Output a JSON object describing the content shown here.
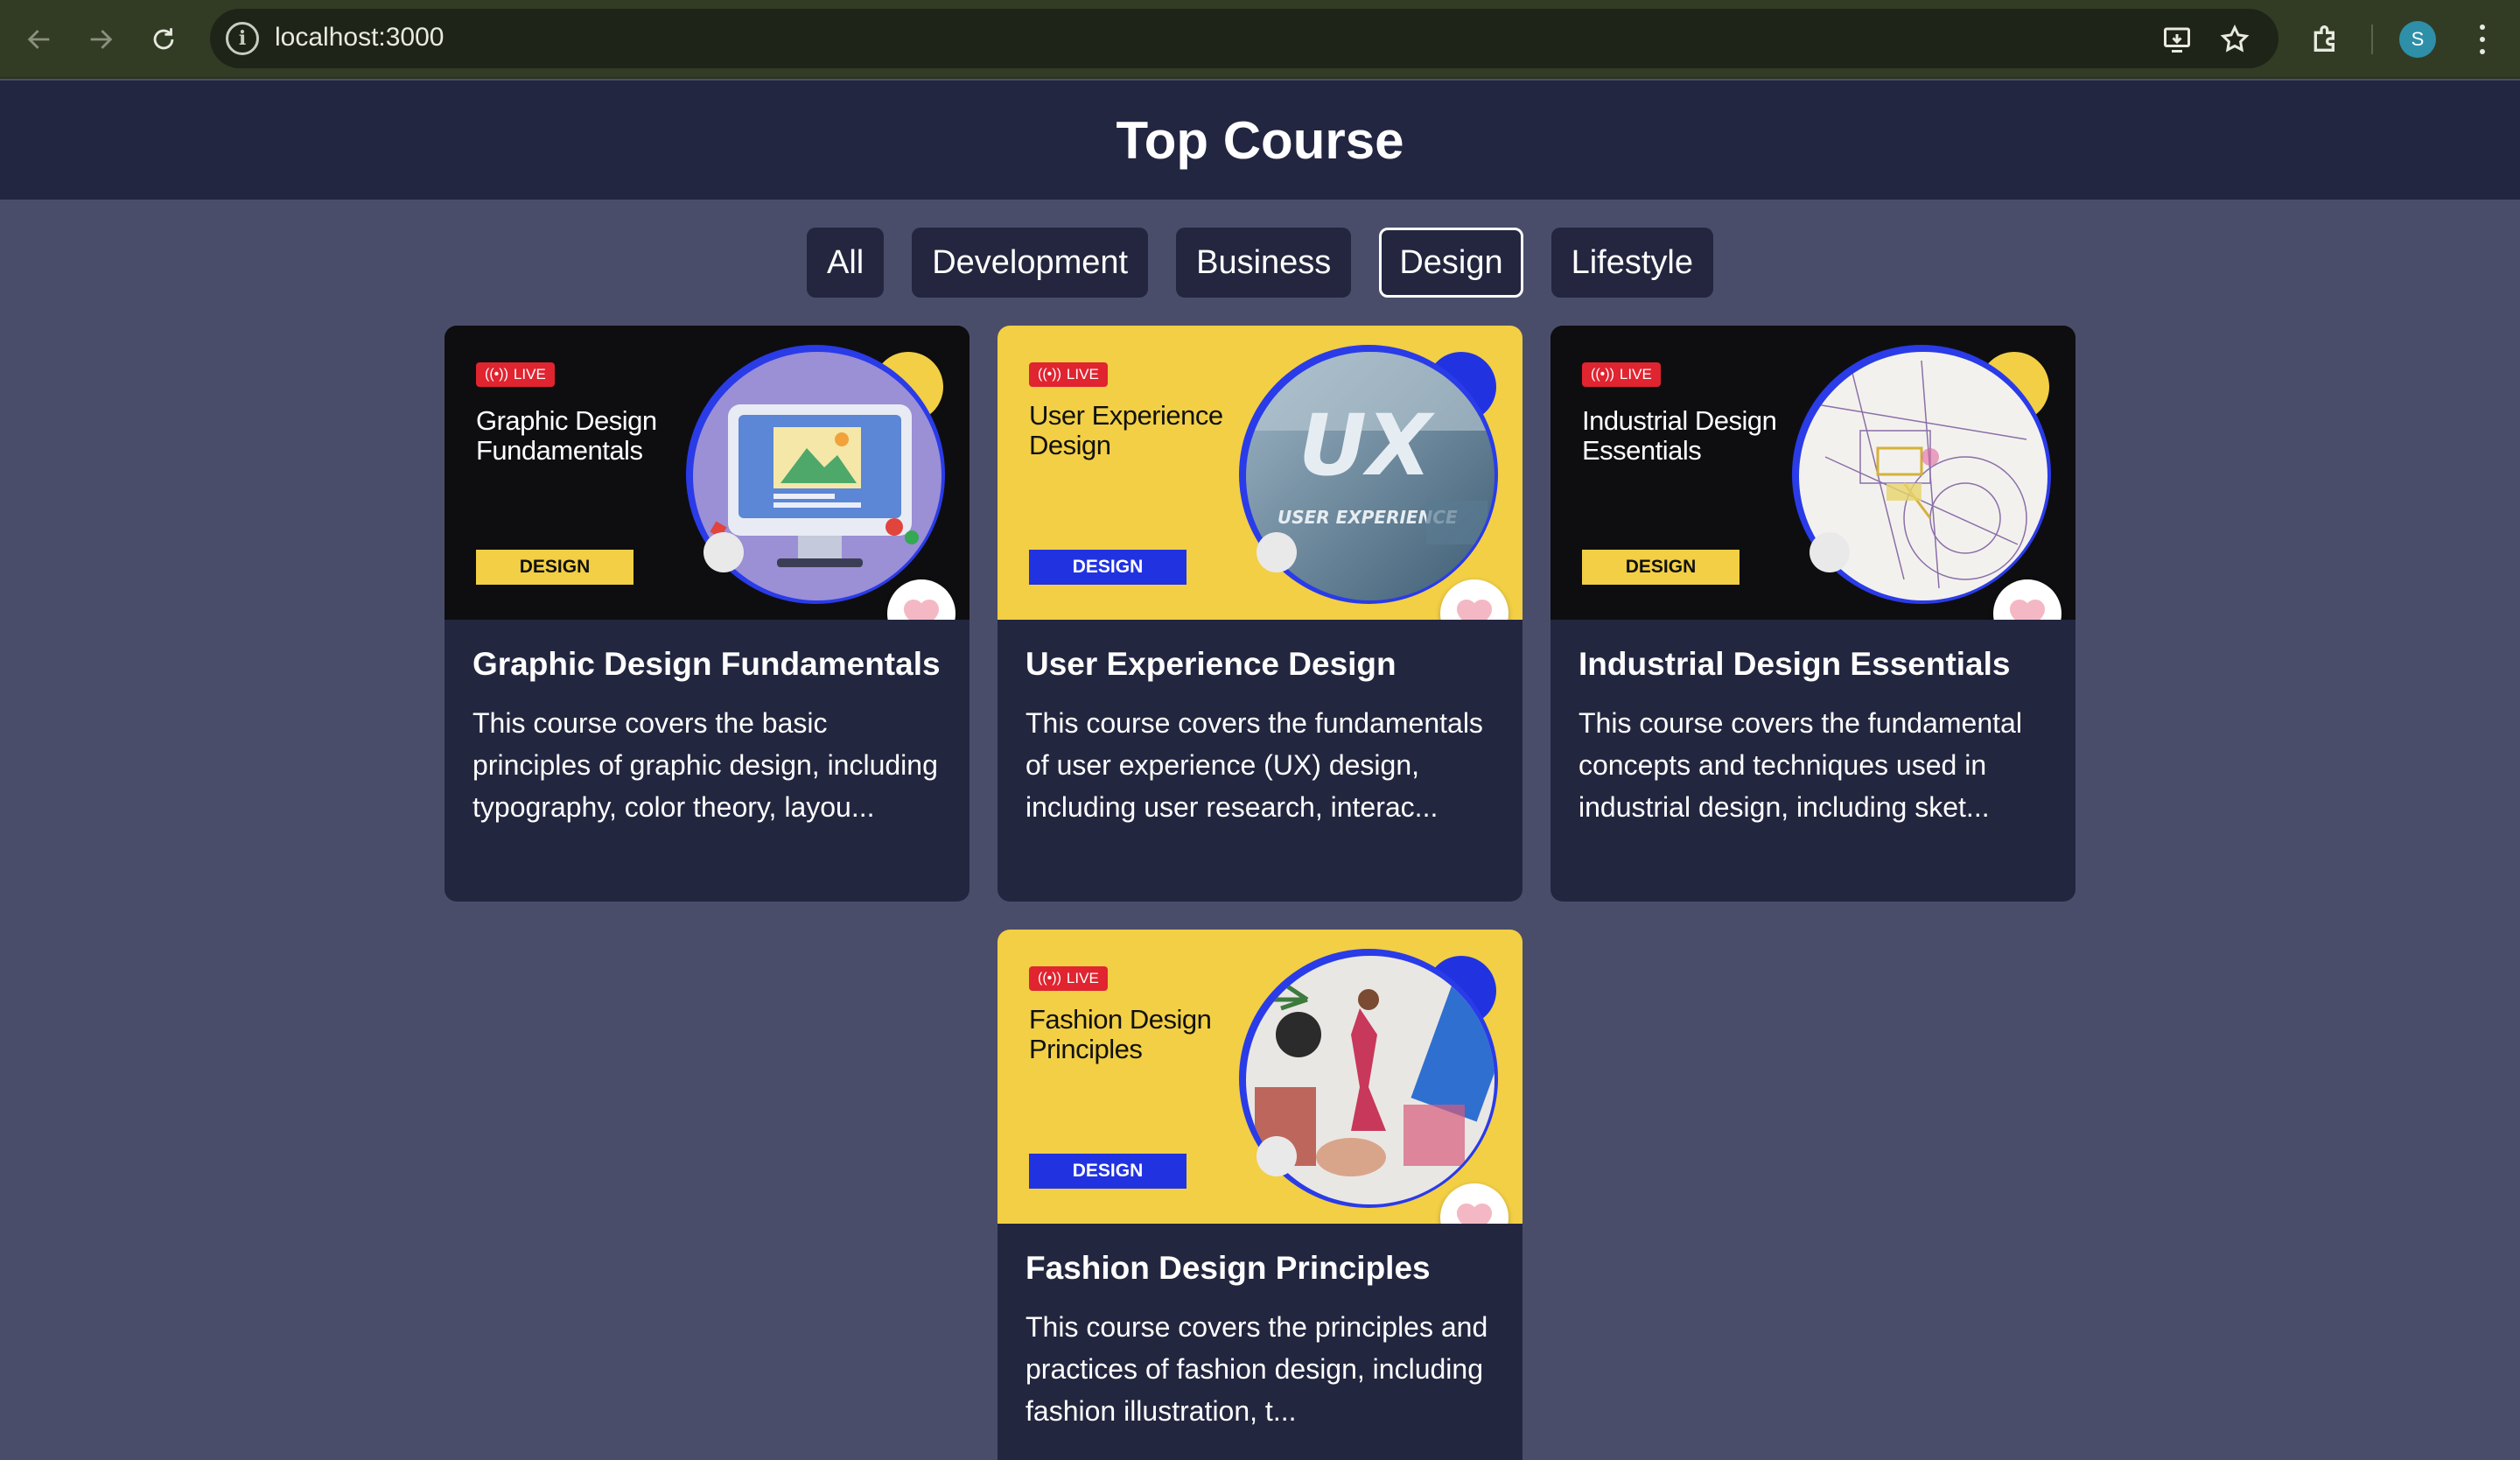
{
  "browser": {
    "url": "localhost:3000",
    "profile_initial": "S"
  },
  "app": {
    "title": "Top Course"
  },
  "filters": [
    {
      "label": "All",
      "active": false
    },
    {
      "label": "Development",
      "active": false
    },
    {
      "label": "Business",
      "active": false
    },
    {
      "label": "Design",
      "active": true
    },
    {
      "label": "Lifestyle",
      "active": false
    }
  ],
  "courses": [
    {
      "thumb_live": "LIVE",
      "thumb_title": "Graphic Design Fundamentals",
      "thumb_tag": "DESIGN",
      "title": "Graphic Design Fundamentals",
      "description": "This course covers the basic principles of graphic design, including typography, color theory, layou..."
    },
    {
      "thumb_live": "LIVE",
      "thumb_title": "User Experience Design",
      "thumb_tag": "DESIGN",
      "thumb_image_text": "UX",
      "thumb_image_caption": "USER EXPERIENCE",
      "title": "User Experience Design",
      "description": "This course covers the fundamentals of user experience (UX) design, including user research, interac..."
    },
    {
      "thumb_live": "LIVE",
      "thumb_title": "Industrial Design Essentials",
      "thumb_tag": "DESIGN",
      "title": "Industrial Design Essentials",
      "description": "This course covers the fundamental concepts and techniques used in industrial design, including sket..."
    },
    {
      "thumb_live": "LIVE",
      "thumb_title": "Fashion Design Principles",
      "thumb_tag": "DESIGN",
      "title": "Fashion Design Principles",
      "description": "This course covers the principles and practices of fashion design, including fashion illustration, t..."
    }
  ],
  "colors": {
    "page_bg": "#4a4d6a",
    "header_bg": "#222641",
    "card_bg": "#23263f",
    "accent_yellow": "#f2cf45",
    "accent_blue": "#2133e0",
    "live_red": "#e02430",
    "heart_pink": "#f4b8c4"
  },
  "icons": {
    "back": "arrow-left-icon",
    "forward": "arrow-right-icon",
    "reload": "reload-icon",
    "site_info": "info-icon",
    "install": "install-app-icon",
    "bookmark": "star-icon",
    "extensions": "puzzle-icon",
    "menu": "kebab-menu-icon",
    "favorite": "heart-icon"
  }
}
